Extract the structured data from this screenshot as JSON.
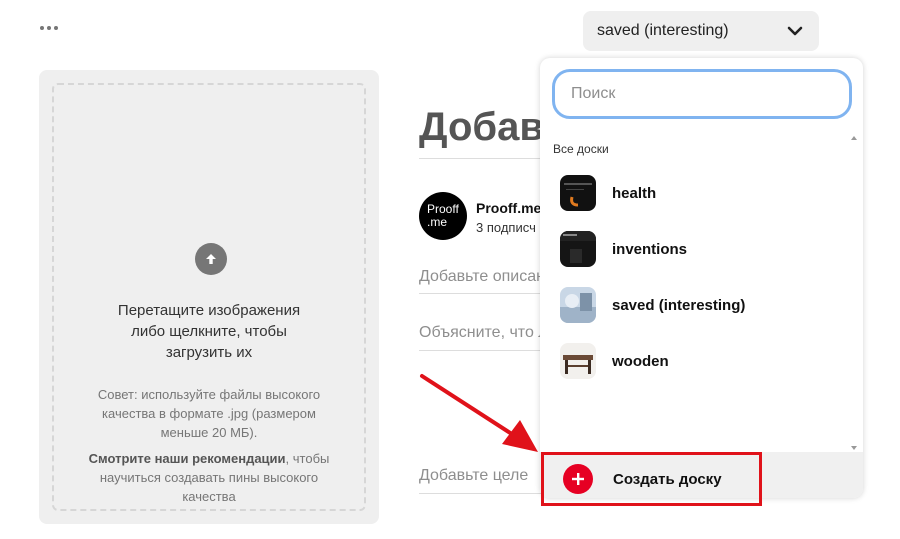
{
  "header": {
    "board_selected": "saved (interesting)"
  },
  "upload": {
    "main_text_1": "Перетащите изображения",
    "main_text_2": "либо щелкните, чтобы",
    "main_text_3": "загрузить их",
    "tip_1": "Совет: используйте файлы высокого",
    "tip_2": "качества в формате .jpg (размером",
    "tip_3": "меньше 20 МБ).",
    "rec_bold": "Смотрите наши рекомендации",
    "rec_1": ", чтобы",
    "rec_2": "научиться создавать пины высокого",
    "rec_3": "качества"
  },
  "form": {
    "title": "Добавь",
    "user_name": "Prooff.me",
    "user_subs": "3 подписч",
    "description_placeholder": "Добавьте описан",
    "explain_placeholder": "Объясните, что л",
    "link_placeholder": "Добавьте целе",
    "avatar_line1": "Prooff",
    "avatar_line2": ".me"
  },
  "dropdown": {
    "search_placeholder": "Поиск",
    "section_label": "Все доски",
    "boards": [
      {
        "name": "health"
      },
      {
        "name": "inventions"
      },
      {
        "name": "saved (interesting)"
      },
      {
        "name": "wooden"
      }
    ],
    "create_label": "Создать доску"
  },
  "colors": {
    "accent_red": "#e60023",
    "highlight_red": "#e0121a",
    "focus_blue": "#80b4f0"
  }
}
